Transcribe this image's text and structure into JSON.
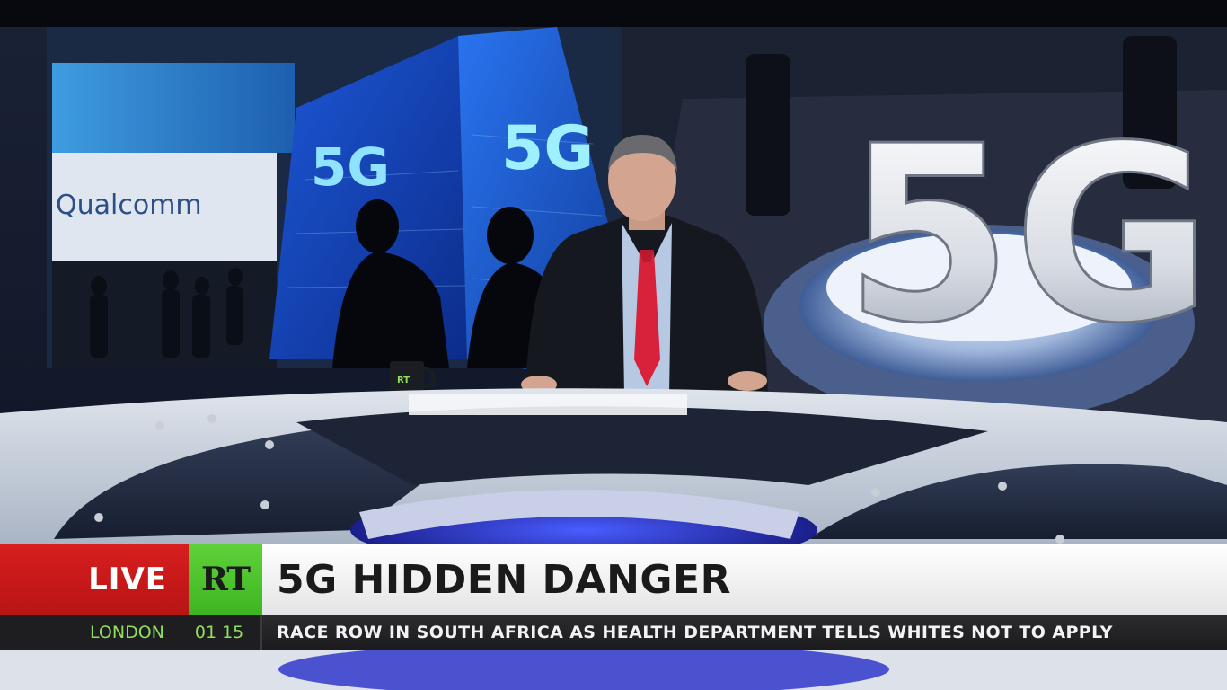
{
  "background": {
    "wall_logo": "Qualcomm",
    "screen_text_1": "5G",
    "screen_text_2": "5G",
    "big_3d_text": "5G",
    "mug_logo": "RT"
  },
  "lower_third": {
    "live_label": "LIVE",
    "channel_logo": "RT",
    "headline": "5G HIDDEN DANGER",
    "location": "LONDON",
    "time": "01 15",
    "ticker": "RACE ROW IN SOUTH AFRICA AS HEALTH DEPARTMENT TELLS WHITES NOT TO APPLY"
  },
  "colors": {
    "live_red": "#d81e1e",
    "rt_green": "#4ec22c",
    "clock_green": "#8fe05a",
    "headline_bg": "#ffffff",
    "ticker_bg": "#232326"
  }
}
